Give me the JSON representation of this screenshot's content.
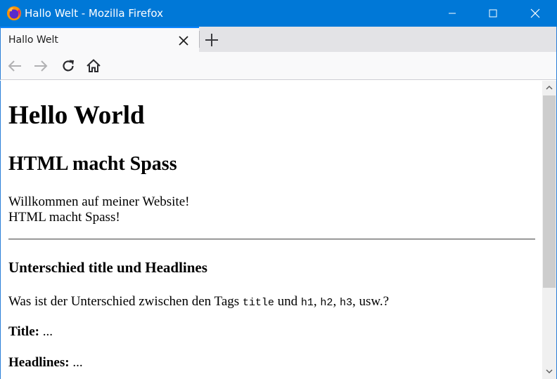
{
  "window": {
    "title": "Hallo Welt - Mozilla Firefox",
    "titlebar_color": "#0078d7",
    "icons": [
      "firefox-logo-icon",
      "minimize-icon",
      "maximize-icon",
      "close-icon"
    ]
  },
  "tabs": [
    {
      "label": "Hallo Welt",
      "active": true
    }
  ],
  "toolbar": {
    "icons": [
      "back-arrow-icon",
      "forward-arrow-icon",
      "reload-icon",
      "home-icon",
      "new-tab-plus-icon"
    ]
  },
  "content": {
    "h1": "Hello World",
    "h2": "HTML macht Spass",
    "intro_line1": "Willkommen auf meiner Website!",
    "intro_line2": "HTML macht Spass!",
    "h3": "Unterschied title und Headlines",
    "question": {
      "text1": "Was ist der Unterschied zwischen den Tags ",
      "code_title": "title",
      "text2": " und ",
      "code_h1": "h1",
      "sep1": ", ",
      "code_h2": "h2",
      "sep2": ", ",
      "code_h3": "h3",
      "text3": ", usw.?"
    },
    "title_label": "Title:",
    "title_value": " ...",
    "headlines_label": "Headlines:",
    "headlines_value": " ..."
  }
}
